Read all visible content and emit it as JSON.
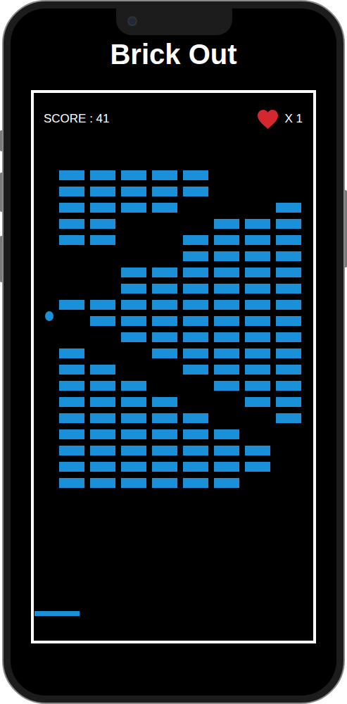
{
  "title": "Brick Out",
  "score": "SCORE : 41",
  "lives": "X 1",
  "bricks": [
    [
      true,
      true,
      true,
      true,
      true,
      false,
      false,
      false
    ],
    [
      true,
      true,
      true,
      true,
      true,
      false,
      false,
      false
    ],
    [
      true,
      true,
      true,
      true,
      false,
      false,
      false,
      true
    ],
    [
      true,
      true,
      false,
      false,
      false,
      true,
      true,
      true
    ],
    [
      true,
      true,
      false,
      false,
      true,
      true,
      true,
      true
    ],
    [
      false,
      false,
      false,
      false,
      true,
      true,
      true,
      true
    ],
    [
      false,
      false,
      true,
      true,
      true,
      true,
      true,
      true
    ],
    [
      false,
      false,
      true,
      true,
      true,
      true,
      true,
      true
    ],
    [
      true,
      true,
      true,
      true,
      true,
      true,
      true,
      true
    ],
    [
      false,
      true,
      true,
      true,
      true,
      true,
      true,
      true
    ],
    [
      false,
      false,
      true,
      true,
      true,
      true,
      true,
      true
    ],
    [
      true,
      false,
      false,
      true,
      true,
      true,
      true,
      true
    ],
    [
      true,
      true,
      false,
      false,
      true,
      true,
      true,
      true
    ],
    [
      true,
      true,
      true,
      false,
      false,
      true,
      true,
      true
    ],
    [
      true,
      true,
      true,
      true,
      false,
      false,
      true,
      true
    ],
    [
      true,
      true,
      true,
      true,
      true,
      false,
      false,
      true
    ],
    [
      true,
      true,
      true,
      true,
      true,
      true,
      false,
      false
    ],
    [
      true,
      true,
      true,
      true,
      true,
      true,
      true,
      false
    ],
    [
      true,
      true,
      true,
      true,
      true,
      true,
      true,
      false
    ],
    [
      true,
      true,
      true,
      true,
      true,
      true,
      false,
      false
    ]
  ]
}
